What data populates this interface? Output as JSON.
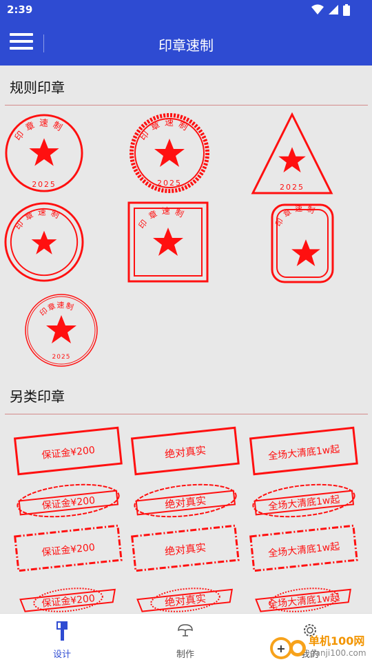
{
  "status": {
    "time": "2:39"
  },
  "app": {
    "title": "印章速制"
  },
  "sections": {
    "regular": "规则印章",
    "other": "另类印章"
  },
  "stamp": {
    "text": "印章速制",
    "year": "2025"
  },
  "rect_stamps": {
    "a": "保证金¥200",
    "b": "绝对真实",
    "c": "全场大清底1w起"
  },
  "nav": {
    "design": "设计",
    "make": "制作",
    "mine": "我的"
  },
  "colors": {
    "primary": "#2e4bd2",
    "stamp_red": "#ff1010",
    "active_nav": "#2e4bd2"
  },
  "watermark": {
    "brand": "单机100网",
    "url": "danji100.com"
  }
}
